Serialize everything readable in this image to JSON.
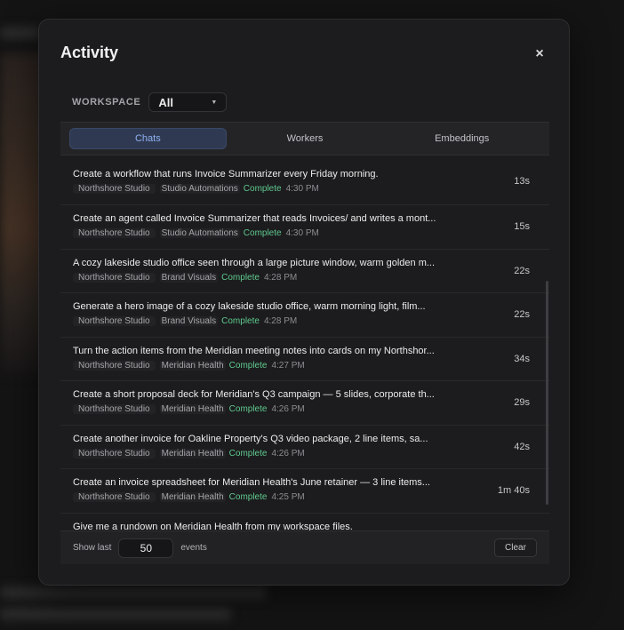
{
  "modal": {
    "title": "Activity",
    "close_glyph": "×"
  },
  "workspace": {
    "label": "WORKSPACE",
    "selected": "All",
    "caret_glyph": "▼"
  },
  "tabs": [
    {
      "label": "Chats",
      "active": true
    },
    {
      "label": "Workers",
      "active": false
    },
    {
      "label": "Embeddings",
      "active": false
    }
  ],
  "events": [
    {
      "title": "Create a workflow that runs Invoice Summarizer every Friday morning.",
      "workspace": "Northshore Studio",
      "project": "Studio Automations",
      "status": "Complete",
      "time": "4:30 PM",
      "duration": "13s"
    },
    {
      "title": "Create an agent called Invoice Summarizer that reads Invoices/ and writes a mont...",
      "workspace": "Northshore Studio",
      "project": "Studio Automations",
      "status": "Complete",
      "time": "4:30 PM",
      "duration": "15s"
    },
    {
      "title": "A cozy lakeside studio office seen through a large picture window, warm golden m...",
      "workspace": "Northshore Studio",
      "project": "Brand Visuals",
      "status": "Complete",
      "time": "4:28 PM",
      "duration": "22s"
    },
    {
      "title": "Generate a hero image of a cozy lakeside studio office, warm morning light, film...",
      "workspace": "Northshore Studio",
      "project": "Brand Visuals",
      "status": "Complete",
      "time": "4:28 PM",
      "duration": "22s"
    },
    {
      "title": "Turn the action items from the Meridian meeting notes into cards on my Northshor...",
      "workspace": "Northshore Studio",
      "project": "Meridian Health",
      "status": "Complete",
      "time": "4:27 PM",
      "duration": "34s"
    },
    {
      "title": "Create a short proposal deck for Meridian's Q3 campaign — 5 slides, corporate th...",
      "workspace": "Northshore Studio",
      "project": "Meridian Health",
      "status": "Complete",
      "time": "4:26 PM",
      "duration": "29s"
    },
    {
      "title": "Create another invoice for Oakline Property's Q3 video package, 2 line items, sa...",
      "workspace": "Northshore Studio",
      "project": "Meridian Health",
      "status": "Complete",
      "time": "4:26 PM",
      "duration": "42s"
    },
    {
      "title": "Create an invoice spreadsheet for Meridian Health's June retainer — 3 line items...",
      "workspace": "Northshore Studio",
      "project": "Meridian Health",
      "status": "Complete",
      "time": "4:25 PM",
      "duration": "1m 40s"
    },
    {
      "title": "Give me a rundown on Meridian Health from my workspace files.",
      "workspace": "",
      "project": "",
      "status": "",
      "time": "",
      "duration": ""
    }
  ],
  "footer": {
    "show_last_label": "Show last",
    "count_value": "50",
    "events_label": "events",
    "clear_label": "Clear"
  },
  "colors": {
    "accent_tab": "#8fb0f0",
    "status_complete": "#5fc98e",
    "modal_bg": "#1c1c1e"
  }
}
